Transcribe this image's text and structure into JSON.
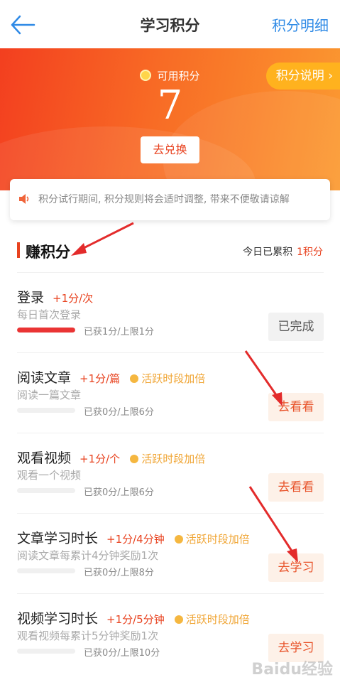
{
  "nav": {
    "title": "学习积分",
    "detail_link": "积分明细"
  },
  "banner": {
    "available_label": "可用积分",
    "points": "7",
    "redeem_button": "去兑换",
    "explain_button": "积分说明 ›"
  },
  "notice": {
    "text": "积分试行期间, 积分规则将会适时调整, 带来不便敬请谅解"
  },
  "section": {
    "title": "赚积分",
    "today_label": "今日已累积",
    "today_value": "1积分"
  },
  "tasks": [
    {
      "name": "登录",
      "rate": "+1分/次",
      "boost": "",
      "desc": "每日首次登录",
      "progress": "已获1分/上限1分",
      "progress_fraction": 1.0,
      "action": "已完成",
      "done": true
    },
    {
      "name": "阅读文章",
      "rate": "+1分/篇",
      "boost": "活跃时段加倍",
      "desc": "阅读一篇文章",
      "progress": "已获0分/上限6分",
      "progress_fraction": 0,
      "action": "去看看",
      "done": false
    },
    {
      "name": "观看视频",
      "rate": "+1分/个",
      "boost": "活跃时段加倍",
      "desc": "观看一个视频",
      "progress": "已获0分/上限6分",
      "progress_fraction": 0,
      "action": "去看看",
      "done": false
    },
    {
      "name": "文章学习时长",
      "rate": "+1分/4分钟",
      "boost": "活跃时段加倍",
      "desc": "阅读文章每累计4分钟奖励1次",
      "progress": "已获0分/上限8分",
      "progress_fraction": 0,
      "action": "去学习",
      "done": false
    },
    {
      "name": "视频学习时长",
      "rate": "+1分/5分钟",
      "boost": "活跃时段加倍",
      "desc": "观看视频每累计5分钟奖励1次",
      "progress": "已获0分/上限10分",
      "progress_fraction": 0,
      "action": "去学习",
      "done": false
    }
  ],
  "watermark": "Baidu经验",
  "colors": {
    "accent": "#e8421f",
    "link": "#2f8ae6",
    "boost": "#f0a534"
  }
}
